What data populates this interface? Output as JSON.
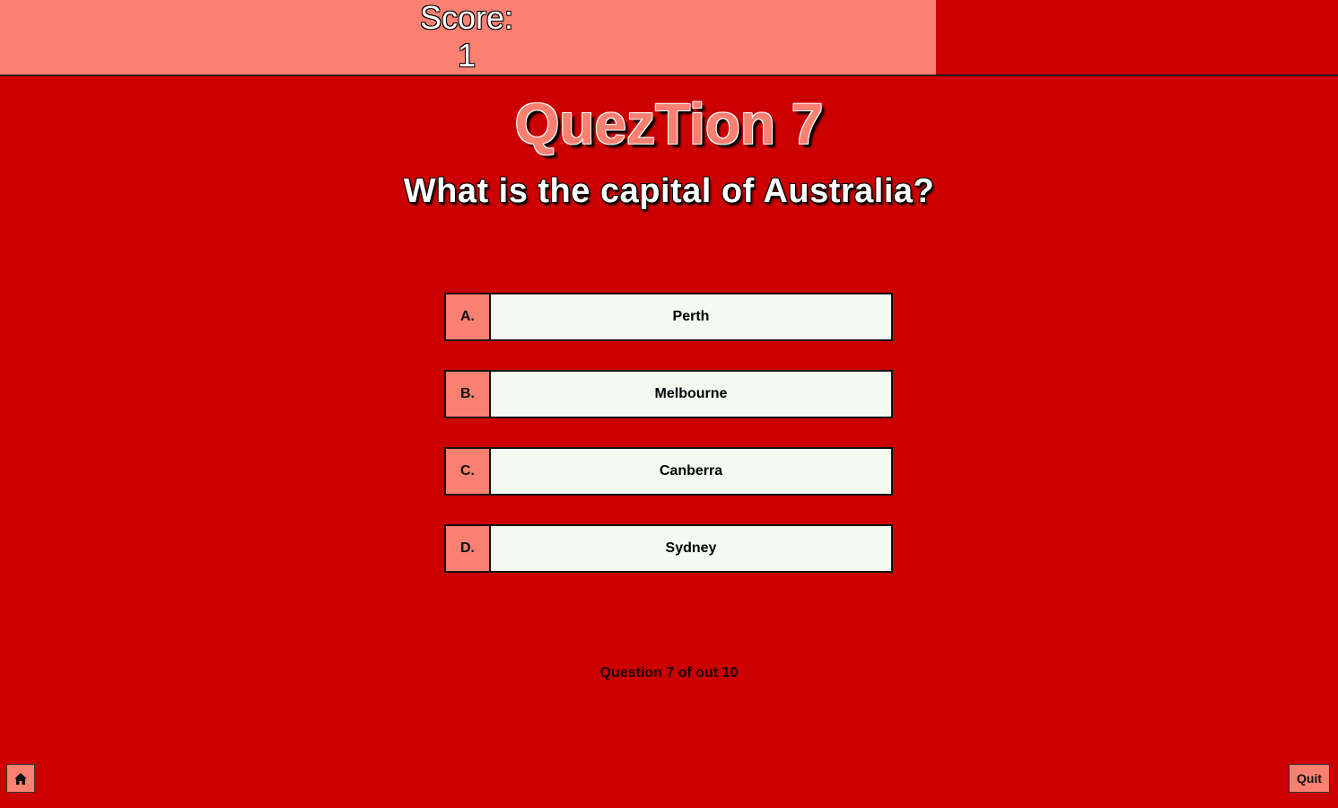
{
  "score": {
    "label": "Score:",
    "value": "1"
  },
  "title": "QuezTion 7",
  "question": "What is the capital of Australia?",
  "answers": [
    {
      "letter": "A.",
      "text": "Perth"
    },
    {
      "letter": "B.",
      "text": "Melbourne"
    },
    {
      "letter": "C.",
      "text": "Canberra"
    },
    {
      "letter": "D.",
      "text": "Sydney"
    }
  ],
  "progress": "Question 7 of out 10",
  "footer": {
    "home_icon": "home-icon",
    "quit_label": "Quit"
  },
  "colors": {
    "background": "#cc0000",
    "accent": "#fa8072",
    "answer_bg": "#f4faf0"
  }
}
